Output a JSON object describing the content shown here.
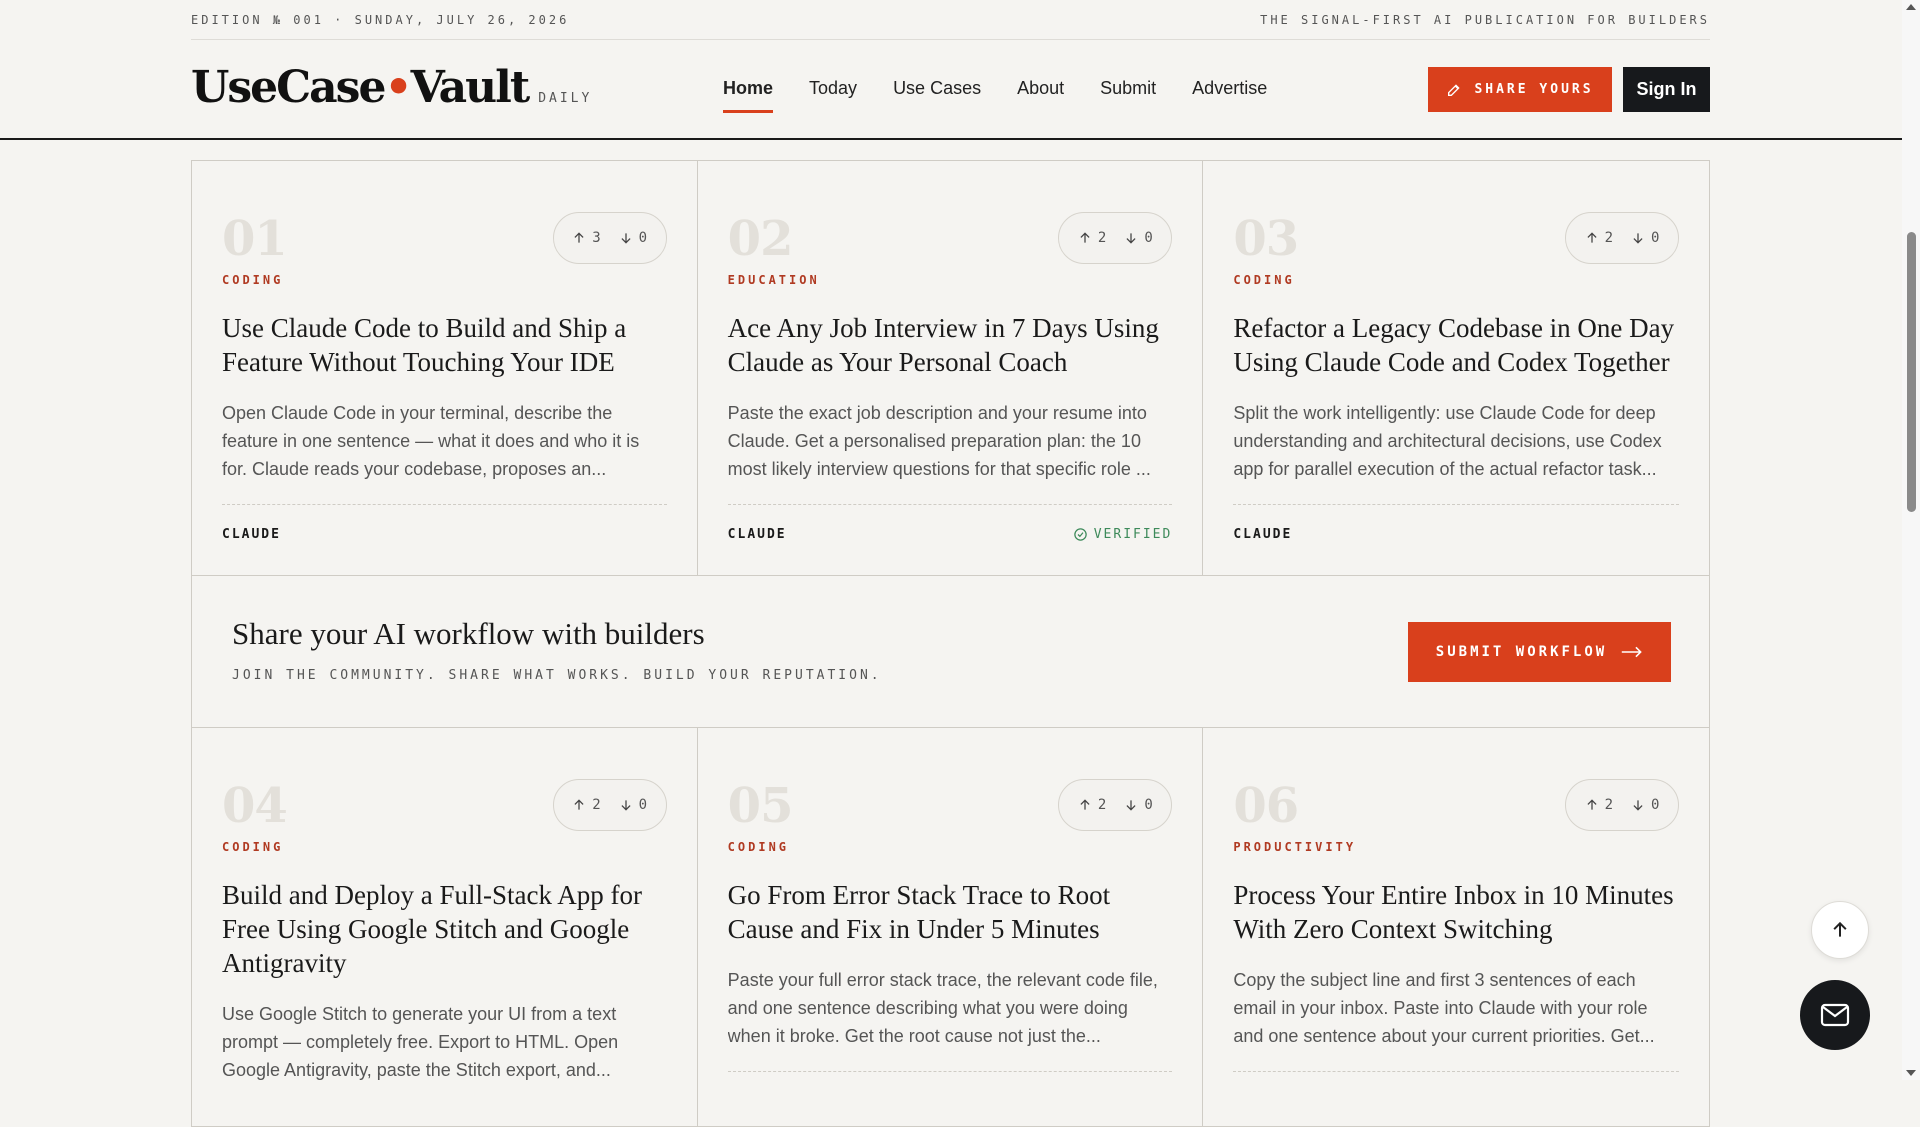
{
  "header": {
    "edition": "EDITION № 001 · SUNDAY, JULY 26, 2026",
    "tagline": "THE SIGNAL-FIRST AI PUBLICATION FOR BUILDERS",
    "logo_part1": "UseCase",
    "logo_dot": "•",
    "logo_part2": "Vault",
    "logo_sub": "DAILY",
    "nav": [
      "Home",
      "Today",
      "Use Cases",
      "About",
      "Submit",
      "Advertise"
    ],
    "share_label": "SHARE YOURS",
    "signin_label": "Sign In"
  },
  "cards": [
    {
      "num": "01",
      "up": "3",
      "down": "0",
      "category": "CODING",
      "title": "Use Claude Code to Build and Ship a Feature Without Touching Your IDE",
      "excerpt": "Open Claude Code in your terminal, describe the feature in one sentence — what it does and who it is for. Claude reads your codebase, proposes an...",
      "tool": "CLAUDE",
      "verified": ""
    },
    {
      "num": "02",
      "up": "2",
      "down": "0",
      "category": "EDUCATION",
      "title": "Ace Any Job Interview in 7 Days Using Claude as Your Personal Coach",
      "excerpt": "Paste the exact job description and your resume into Claude. Get a personalised preparation plan: the 10 most likely interview questions for that specific role ...",
      "tool": "CLAUDE",
      "verified": "VERIFIED"
    },
    {
      "num": "03",
      "up": "2",
      "down": "0",
      "category": "CODING",
      "title": "Refactor a Legacy Codebase in One Day Using Claude Code and Codex Together",
      "excerpt": "Split the work intelligently: use Claude Code for deep understanding and architectural decisions, use Codex app for parallel execution of the actual refactor task...",
      "tool": "CLAUDE",
      "verified": ""
    },
    {
      "num": "04",
      "up": "2",
      "down": "0",
      "category": "CODING",
      "title": "Build and Deploy a Full-Stack App for Free Using Google Stitch and Google Antigravity",
      "excerpt": "Use Google Stitch to generate your UI from a text prompt — completely free. Export to HTML. Open Google Antigravity, paste the Stitch export, and...",
      "tool": "",
      "verified": ""
    },
    {
      "num": "05",
      "up": "2",
      "down": "0",
      "category": "CODING",
      "title": "Go From Error Stack Trace to Root Cause and Fix in Under 5 Minutes",
      "excerpt": "Paste your full error stack trace, the relevant code file, and one sentence describing what you were doing when it broke. Get the root cause not just the...",
      "tool": "",
      "verified": ""
    },
    {
      "num": "06",
      "up": "2",
      "down": "0",
      "category": "PRODUCTIVITY",
      "title": "Process Your Entire Inbox in 10 Minutes With Zero Context Switching",
      "excerpt": "Copy the subject line and first 3 sentences of each email in your inbox. Paste into Claude with your role and one sentence about your current priorities. Get...",
      "tool": "",
      "verified": ""
    }
  ],
  "cta": {
    "title": "Share your AI workflow with builders",
    "subtitle": "JOIN THE COMMUNITY. SHARE WHAT WORKS. BUILD YOUR REPUTATION.",
    "button": "SUBMIT WORKFLOW"
  },
  "colors": {
    "accent": "#d9401c",
    "dark": "#17191c",
    "background": "#f5f4f1",
    "verified": "#3d8a5a"
  },
  "icons": [
    "pencil-icon",
    "arrow-up-icon",
    "arrow-down-icon",
    "check-circle-icon",
    "arrow-right-icon",
    "mail-icon"
  ]
}
